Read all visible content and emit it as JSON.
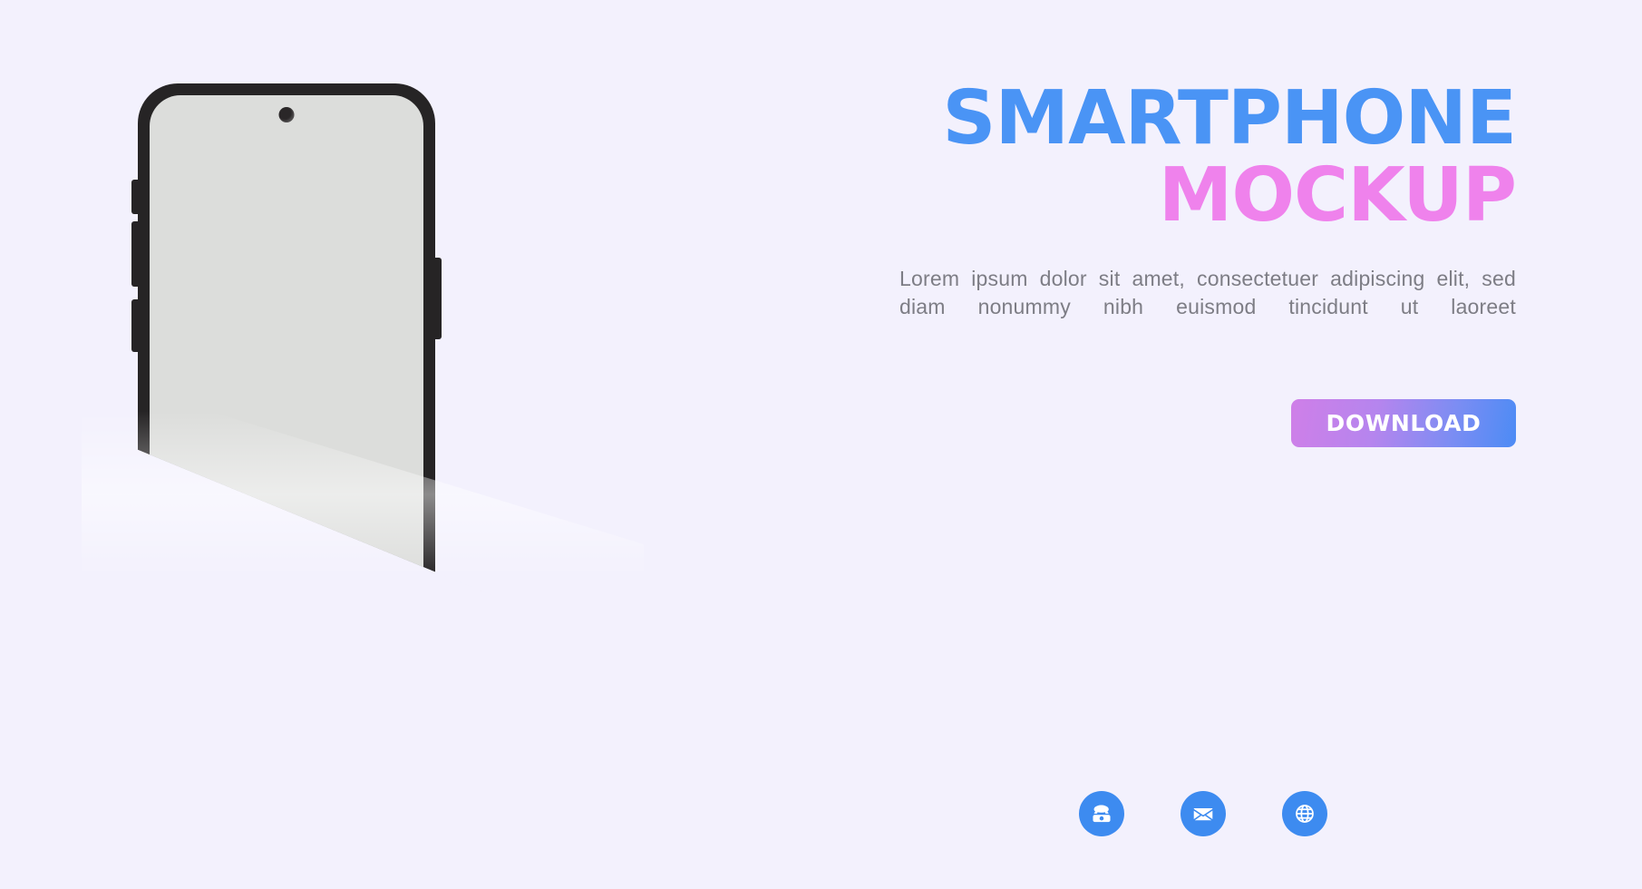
{
  "background_color": "#f3f1fd",
  "hero": {
    "headline_line1": "SMARTPHONE",
    "headline_line2": "MOCKUP",
    "headline_line1_color": "#4a94f5",
    "headline_line2_color": "#ef82ec",
    "subtext": "Lorem ipsum dolor sit amet, consectetuer adipiscing elit, sed diam nonummy nibh euismod tincidunt ut laoreet",
    "subtext_color": "#7d7d85"
  },
  "cta": {
    "download_label": "DOWNLOAD",
    "gradient_from": "#cf7fe8",
    "gradient_to": "#4c8bf5",
    "label_color": "#ffffff"
  },
  "device": {
    "frame_color": "#262425",
    "screen_color": "#dcdddb",
    "camera_name": "front-camera-punch-hole",
    "side_buttons": [
      {
        "name": "volume-up-button",
        "side": "left"
      },
      {
        "name": "volume-down-button",
        "side": "left"
      },
      {
        "name": "bixby-button",
        "side": "left"
      },
      {
        "name": "power-button",
        "side": "right"
      }
    ]
  },
  "contacts": {
    "accent_color": "#3d8bf0",
    "items": [
      {
        "icon": "telephone-icon",
        "label": "Phone"
      },
      {
        "icon": "envelope-icon",
        "label": "Email"
      },
      {
        "icon": "globe-icon",
        "label": "Website"
      }
    ]
  }
}
